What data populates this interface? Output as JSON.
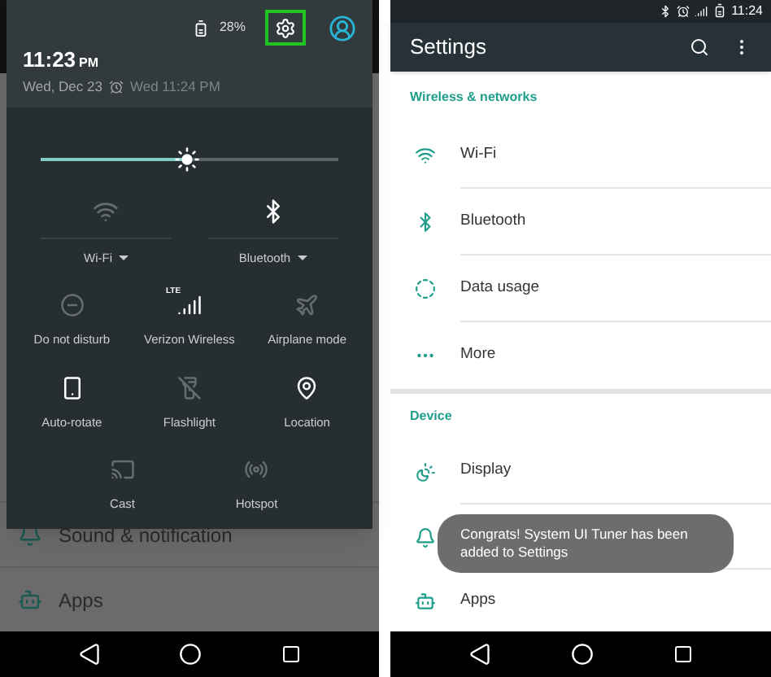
{
  "left_phone": {
    "background_items": [
      {
        "kind": "bell",
        "label": "Sound & notification"
      },
      {
        "kind": "android",
        "label": "Apps"
      }
    ],
    "header": {
      "battery": "28%",
      "settings_highlighted": true,
      "time": "11:23",
      "time_suffix": "PM",
      "date": "Wed, Dec 23",
      "alarm": "Wed 11:24 PM"
    },
    "brightness": {
      "level": 0.49
    },
    "toggles": [
      {
        "kind": "wifi",
        "label": "Wi-Fi",
        "on": false
      },
      {
        "kind": "bluetooth",
        "label": "Bluetooth",
        "on": true
      }
    ],
    "tile_rows": [
      {
        "tiles": [
          {
            "kind": "dnd",
            "label": "Do not disturb",
            "on": false
          },
          {
            "kind": "signal",
            "label": "Verizon Wireless",
            "badge": "LTE",
            "on": true
          },
          {
            "kind": "airplane",
            "label": "Airplane mode",
            "on": false
          }
        ]
      },
      {
        "tiles": [
          {
            "kind": "rotate",
            "label": "Auto-rotate",
            "on": true
          },
          {
            "kind": "flashlight",
            "label": "Flashlight",
            "on": false
          },
          {
            "kind": "location",
            "label": "Location",
            "on": true
          }
        ]
      },
      {
        "tiles": [
          {
            "kind": "cast",
            "label": "Cast",
            "on": false
          },
          {
            "kind": "hotspot",
            "label": "Hotspot",
            "on": false
          }
        ]
      }
    ]
  },
  "right_phone": {
    "status_bar": {
      "time": "11:24"
    },
    "toolbar": {
      "title": "Settings"
    },
    "sections": [
      {
        "title": "Wireless & networks",
        "items": [
          {
            "kind": "wifi",
            "label": "Wi-Fi"
          },
          {
            "kind": "bluetooth",
            "label": "Bluetooth"
          },
          {
            "kind": "data",
            "label": "Data usage"
          },
          {
            "kind": "more",
            "label": "More"
          }
        ]
      },
      {
        "title": "Device",
        "items": [
          {
            "kind": "display",
            "label": "Display"
          },
          {
            "kind": "bell"
          },
          {
            "kind": "android",
            "label": "Apps"
          }
        ]
      }
    ],
    "toast": "Congrats! System UI Tuner has been added to Settings"
  }
}
